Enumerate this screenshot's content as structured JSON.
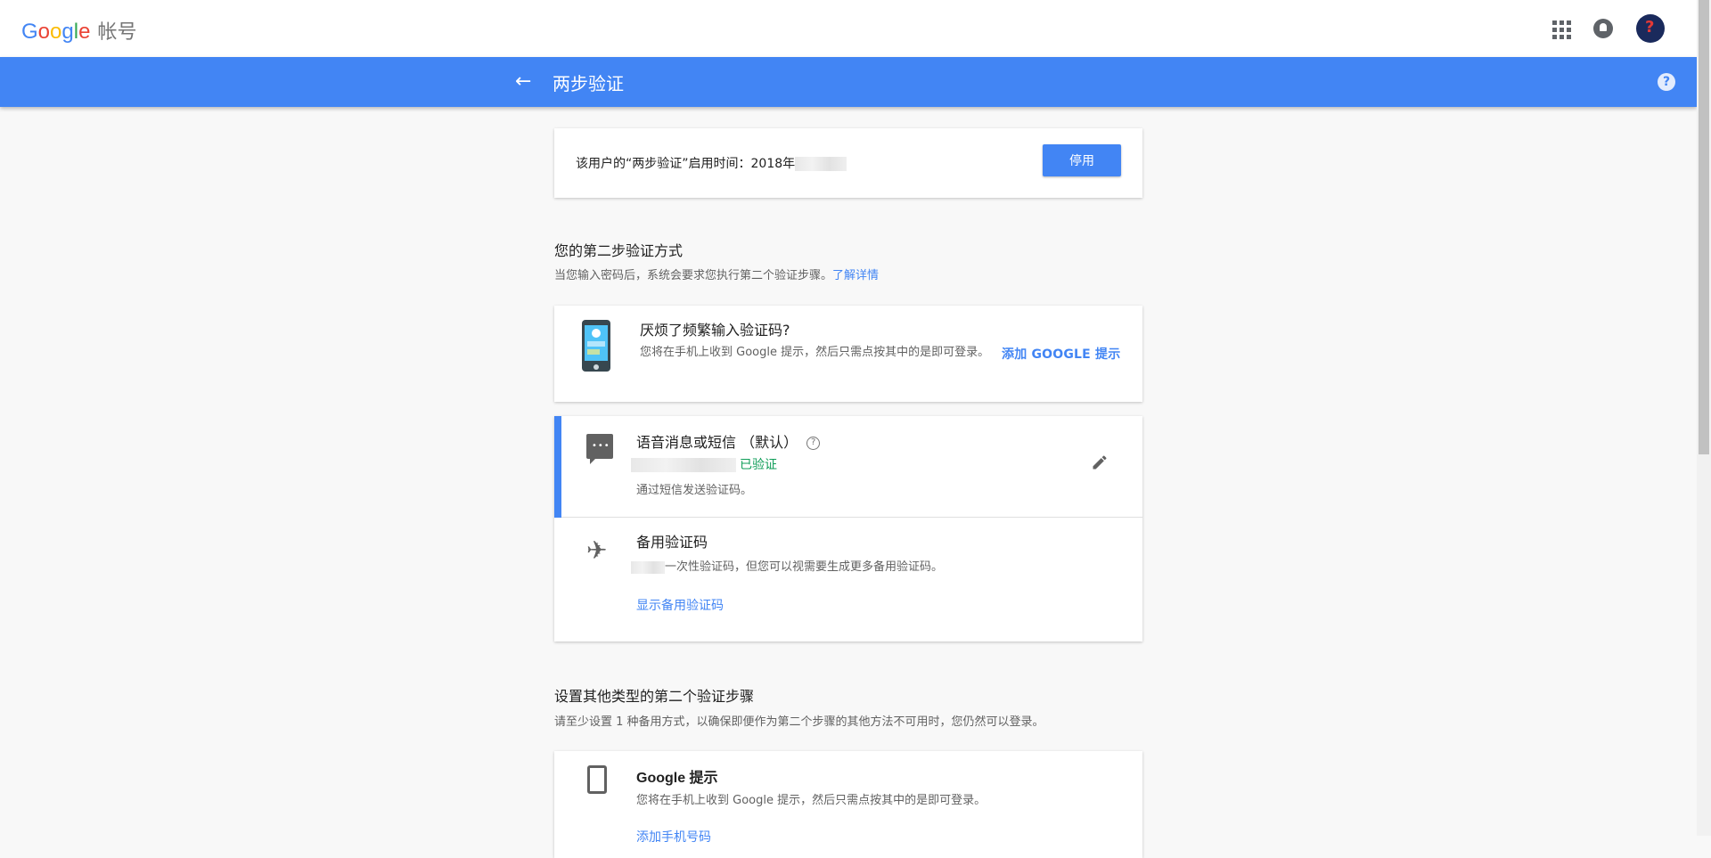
{
  "topbar": {
    "logo_word": "Google",
    "product_label": "帐号"
  },
  "header": {
    "title": "两步验证"
  },
  "status_card": {
    "text": "该用户的“两步验证”启用时间：2018年",
    "disable_label": "停用"
  },
  "second_step": {
    "title": "您的第二步验证方式",
    "desc": "当您输入密码后，系统会要求您执行第二个验证步骤。",
    "learn_more": "了解详情"
  },
  "promo": {
    "title": "厌烦了频繁输入验证码?",
    "desc": "您将在手机上收到 Google 提示，然后只需点按其中的是即可登录。",
    "action": "添加 GOOGLE 提示"
  },
  "default_method": {
    "title": "语音消息或短信 （默认）",
    "verified": "已验证",
    "desc": "通过短信发送验证码。"
  },
  "backup_method": {
    "title": "备用验证码",
    "desc": "一次性验证码，但您可以视需要生成更多备用验证码。",
    "action": "显示备用验证码"
  },
  "other_section": {
    "title": "设置其他类型的第二个验证步骤",
    "desc": "请至少设置 1 种备用方式，以确保即便作为第二个步骤的其他方法不可用时，您仍然可以登录。"
  },
  "google_prompt": {
    "title": "Google 提示",
    "desc": "您将在手机上收到 Google 提示，然后只需点按其中的是即可登录。",
    "action": "添加手机号码"
  },
  "colors": {
    "accent": "#4285f4",
    "verified": "#0f9d58"
  }
}
